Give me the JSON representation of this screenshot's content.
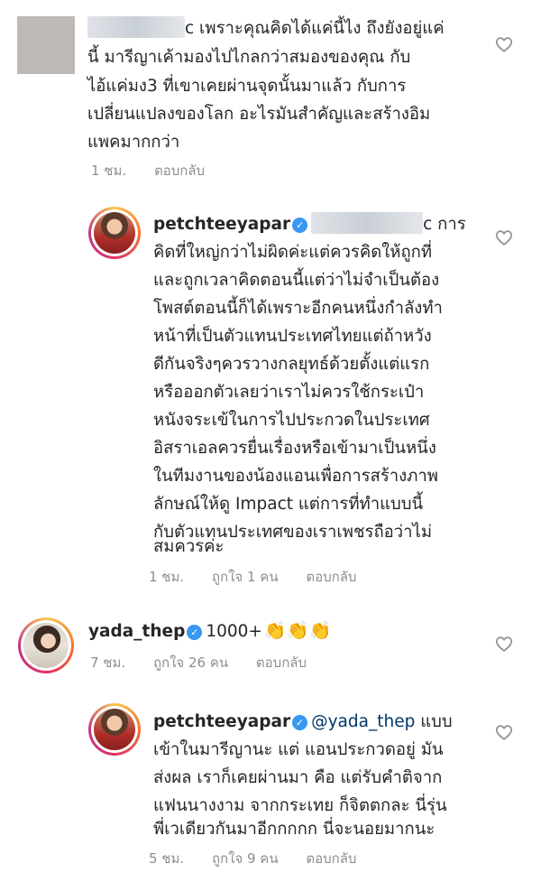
{
  "comments": [
    {
      "id": "c1",
      "username": "",
      "lines": [
        "c เพราะคุณคิดได้แค่นี้ไง ถึงยังอยู่แค่",
        "นี้ มารีญาเค้ามองไปไกลกว่าสมองของคุณ กับ",
        "ไอ้แค่มง3 ที่เขาเคยผ่านจุดนั้นมาแล้ว กับการ",
        "เปลี่ยนแปลงของโลก อะไรมันสำคัญและสร้างอิม",
        "แพคมากกว่า"
      ],
      "time": "1 ชม.",
      "reply": "ตอบกลับ"
    },
    {
      "id": "c2",
      "username": "petchteeyapar",
      "first_line_suffix": "c การ",
      "lines": [
        "คิดที่ใหญ่กว่าไม่ผิดค่ะแต่ควรคิดให้ถูกที่",
        "และถูกเวลาคิดตอนนี้แต่ว่าไม่จำเป็นต้อง",
        "โพสต์ตอนนี้ก็ได้เพราะอีกคนหนึ่งกำลังทำ",
        "หน้าที่เป็นตัวแทนประเทศไทยแต่ถ้าหวัง",
        "ดีกันจริงๆควรวางกลยุทธ์ด้วยตั้งแต่แรก",
        "หรือออกตัวเลยว่าเราไม่ควรใช้กระเป๋า",
        "หนังจระเข้ในการไปประกวดในประเทศ",
        "อิสราเอลควรยื่นเรื่องหรือเข้ามาเป็นหนึ่ง",
        "ในทีมงานของน้องแอนเพื่อการสร้างภาพ",
        "ลักษณ์ให้ดู Impact แต่การที่ทำแบบนี้",
        "กับตัวแทนประเทศของเราเพชรถือว่าไม่",
        "สมควรค่ะ"
      ],
      "time": "1 ชม.",
      "likes": "ถูกใจ 1 คน",
      "reply": "ตอบกลับ"
    },
    {
      "id": "c3",
      "username": "yada_thep",
      "text": "1000+",
      "emoji": "👏👏👏",
      "time": "7 ชม.",
      "likes": "ถูกใจ 26 คน",
      "reply": "ตอบกลับ"
    },
    {
      "id": "c4",
      "username": "petchteeyapar",
      "mention": "@yada_thep",
      "first_line_suffix": "แบบ",
      "lines": [
        "เข้าในมารีญานะ แต่ แอนประกวดอยู่ มัน",
        "ส่งผล เราก็เคยผ่านมา คือ แต่รับคำติจาก",
        "แฟนนางงาม จากกระเทย ก็จิตตกละ นี่รุ่น",
        "พี่เวเดียวกันมาอีกกกกก นี่จะนอยมากนะ"
      ],
      "time": "5 ชม.",
      "likes": "ถูกใจ 9 คน",
      "reply": "ตอบกลับ"
    }
  ],
  "icons": {
    "verified": "verified-badge-icon",
    "heart": "heart-outline-icon",
    "verified_color": "#3897f0"
  }
}
